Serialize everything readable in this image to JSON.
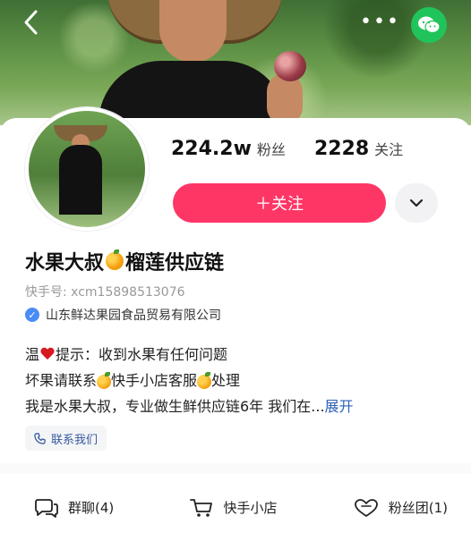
{
  "header": {
    "back_icon": "chevron-left-icon",
    "more_label": "•••",
    "share_icon": "wechat-icon",
    "accent_color": "#20c45a"
  },
  "profile": {
    "followers_count": "224.2w",
    "followers_label": "粉丝",
    "following_count": "2228",
    "following_label": "关注",
    "follow_button_label": "＋关注",
    "name_part1": "水果大叔",
    "name_part2": "榴莲供应链",
    "kuaishou_id": "快手号: xcm15898513076",
    "verified_company": "山东鲜达果园食品贸易有限公司",
    "desc_line1_a": "温",
    "desc_line1_b": "提示：收到水果有任何问题",
    "desc_line2_a": "坏果请联系",
    "desc_line2_b": "快手小店客服",
    "desc_line2_c": "处理",
    "desc_line3": "我是水果大叔，专业做生鲜供应链6年 我们在...",
    "expand_label": "展开",
    "contact_label": "联系我们",
    "brand_color": "#fe3666"
  },
  "bottom": {
    "group_chat": "群聊(4)",
    "shop": "快手小店",
    "fan_club": "粉丝团(1)"
  }
}
